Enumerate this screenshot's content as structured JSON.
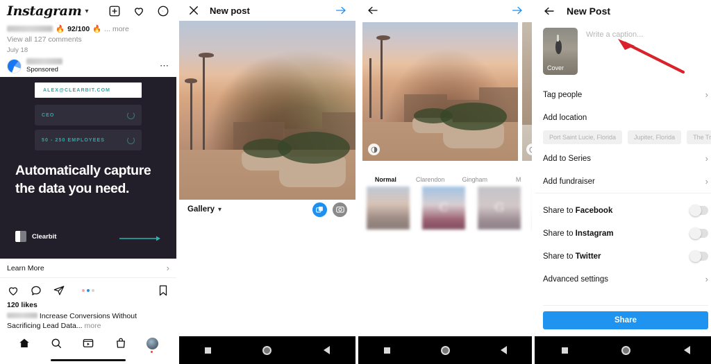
{
  "panel1": {
    "app_name": "Instagram",
    "header_icons": [
      "plus-box-icon",
      "heart-icon",
      "messenger-icon"
    ],
    "post": {
      "caption_score": "92/100",
      "caption_more": "... more",
      "comments": "View all 127 comments",
      "date": "July 18",
      "sponsored_label": "Sponsored"
    },
    "ad": {
      "email_chip": "ALEX@CLEARBIT.COM",
      "role_chip": "CEO",
      "size_chip": "50 - 250 EMPLOYEES",
      "headline": "Automatically capture the data you need.",
      "brand": "Clearbit",
      "cta": "Learn More",
      "bg_color": "#221f2b",
      "accent_color": "#2ea8a5"
    },
    "engagement": {
      "likes": "120 likes",
      "caption": "Increase Conversions Without Sacrificing Lead Data...",
      "caption_more": "more"
    },
    "tabbar": [
      "home-icon",
      "search-icon",
      "reels-icon",
      "shop-icon",
      "profile-avatar"
    ]
  },
  "panel2": {
    "title": "New post",
    "close_icon": "close-icon",
    "next_icon": "arrow-right-icon",
    "gallery_label": "Gallery",
    "multiselect_icon": "multi-select-icon",
    "camera_icon": "camera-icon"
  },
  "panel3": {
    "back_icon": "arrow-left-icon",
    "next_icon": "arrow-right-icon",
    "filters": [
      {
        "name": "Normal",
        "glyph": "",
        "selected": true
      },
      {
        "name": "Clarendon",
        "glyph": "C",
        "selected": false
      },
      {
        "name": "Gingham",
        "glyph": "G",
        "selected": false
      },
      {
        "name": "M",
        "glyph": "",
        "selected": false
      }
    ]
  },
  "panel4": {
    "title": "New Post",
    "back_icon": "arrow-left-icon",
    "cover_label": "Cover",
    "caption_placeholder": "Write a caption...",
    "rows": [
      {
        "label": "Tag people",
        "type": "chevron"
      },
      {
        "label": "Add location",
        "type": "plain"
      },
      {
        "label": "Add to Series",
        "type": "chevron"
      },
      {
        "label": "Add fundraiser",
        "type": "chevron"
      }
    ],
    "location_chips": [
      "Port Saint Lucie, Florida",
      "Jupiter, Florida",
      "The Treasure C"
    ],
    "share_rows": [
      {
        "label_prefix": "Share to ",
        "label_target": "Facebook",
        "enabled": false
      },
      {
        "label_prefix": "Share to ",
        "label_target": "Instagram",
        "enabled": false
      },
      {
        "label_prefix": "Share to ",
        "label_target": "Twitter",
        "enabled": false
      }
    ],
    "advanced_label": "Advanced settings",
    "share_button": "Share",
    "share_button_color": "#1f93f0"
  },
  "android_nav": [
    "square-icon",
    "circle-icon",
    "back-triangle-icon"
  ]
}
